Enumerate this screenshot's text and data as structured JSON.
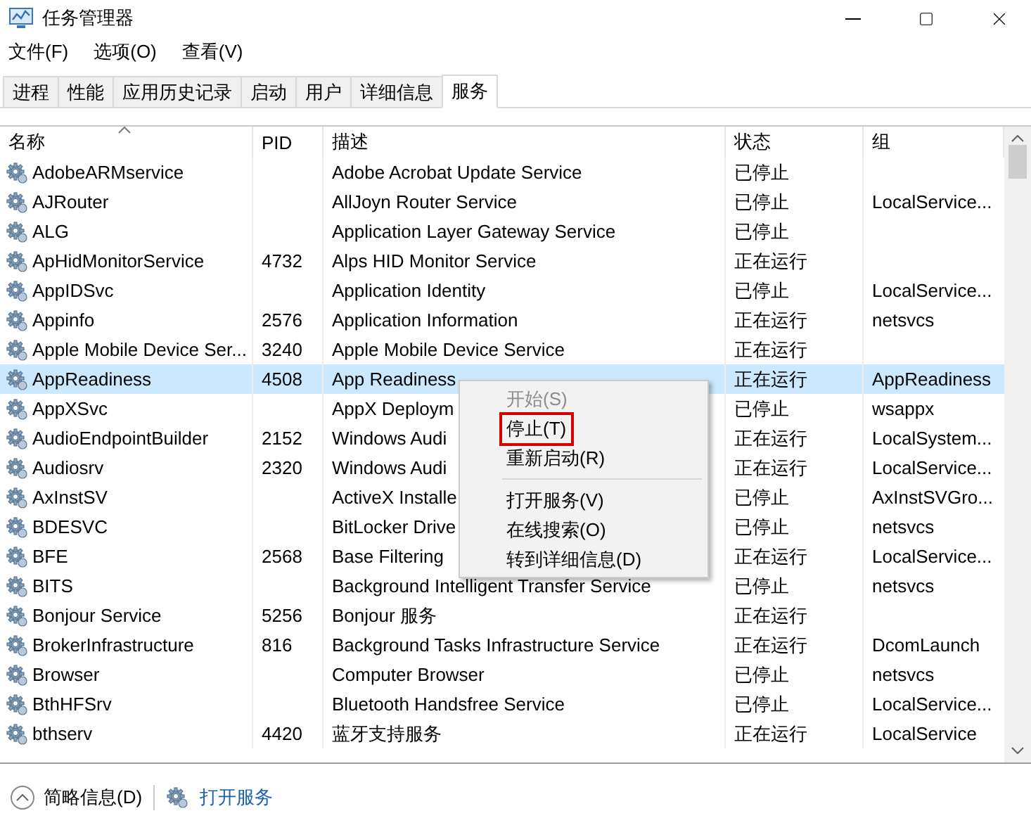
{
  "window": {
    "title": "任务管理器"
  },
  "menu_bar": [
    "文件(F)",
    "选项(O)",
    "查看(V)"
  ],
  "tabs": [
    {
      "label": "进程",
      "selected": false
    },
    {
      "label": "性能",
      "selected": false
    },
    {
      "label": "应用历史记录",
      "selected": false
    },
    {
      "label": "启动",
      "selected": false
    },
    {
      "label": "用户",
      "selected": false
    },
    {
      "label": "详细信息",
      "selected": false
    },
    {
      "label": "服务",
      "selected": true
    }
  ],
  "table": {
    "columns": [
      "名称",
      "PID",
      "描述",
      "状态",
      "组"
    ],
    "rows": [
      {
        "name": "AdobeARMservice",
        "pid": "",
        "description": "Adobe Acrobat Update Service",
        "status": "已停止",
        "group": "",
        "selected": false
      },
      {
        "name": "AJRouter",
        "pid": "",
        "description": "AllJoyn Router Service",
        "status": "已停止",
        "group": "LocalService...",
        "selected": false
      },
      {
        "name": "ALG",
        "pid": "",
        "description": "Application Layer Gateway Service",
        "status": "已停止",
        "group": "",
        "selected": false
      },
      {
        "name": "ApHidMonitorService",
        "pid": "4732",
        "description": "Alps HID Monitor Service",
        "status": "正在运行",
        "group": "",
        "selected": false
      },
      {
        "name": "AppIDSvc",
        "pid": "",
        "description": "Application Identity",
        "status": "已停止",
        "group": "LocalService...",
        "selected": false
      },
      {
        "name": "Appinfo",
        "pid": "2576",
        "description": "Application Information",
        "status": "正在运行",
        "group": "netsvcs",
        "selected": false
      },
      {
        "name": "Apple Mobile Device Ser...",
        "pid": "3240",
        "description": "Apple Mobile Device Service",
        "status": "正在运行",
        "group": "",
        "selected": false
      },
      {
        "name": "AppReadiness",
        "pid": "4508",
        "description": "App Readiness",
        "status": "正在运行",
        "group": "AppReadiness",
        "selected": true
      },
      {
        "name": "AppXSvc",
        "pid": "",
        "description": "AppX Deploym",
        "status": "已停止",
        "group": "wsappx",
        "selected": false
      },
      {
        "name": "AudioEndpointBuilder",
        "pid": "2152",
        "description": "Windows Audi",
        "status": "正在运行",
        "group": "LocalSystem...",
        "selected": false
      },
      {
        "name": "Audiosrv",
        "pid": "2320",
        "description": "Windows Audi",
        "status": "正在运行",
        "group": "LocalService...",
        "selected": false
      },
      {
        "name": "AxInstSV",
        "pid": "",
        "description": "ActiveX Installe",
        "status": "已停止",
        "group": "AxInstSVGro...",
        "selected": false
      },
      {
        "name": "BDESVC",
        "pid": "",
        "description": "BitLocker Drive",
        "status": "已停止",
        "group": "netsvcs",
        "selected": false
      },
      {
        "name": "BFE",
        "pid": "2568",
        "description": "Base Filtering",
        "status": "正在运行",
        "group": "LocalService...",
        "selected": false
      },
      {
        "name": "BITS",
        "pid": "",
        "description": "Background Intelligent Transfer Service",
        "status": "已停止",
        "group": "netsvcs",
        "selected": false
      },
      {
        "name": "Bonjour Service",
        "pid": "5256",
        "description": "Bonjour 服务",
        "status": "正在运行",
        "group": "",
        "selected": false
      },
      {
        "name": "BrokerInfrastructure",
        "pid": "816",
        "description": "Background Tasks Infrastructure Service",
        "status": "正在运行",
        "group": "DcomLaunch",
        "selected": false
      },
      {
        "name": "Browser",
        "pid": "",
        "description": "Computer Browser",
        "status": "已停止",
        "group": "netsvcs",
        "selected": false
      },
      {
        "name": "BthHFSrv",
        "pid": "",
        "description": "Bluetooth Handsfree Service",
        "status": "已停止",
        "group": "LocalService...",
        "selected": false
      },
      {
        "name": "bthserv",
        "pid": "4420",
        "description": "蓝牙支持服务",
        "status": "正在运行",
        "group": "LocalService",
        "selected": false
      }
    ]
  },
  "context_menu": [
    {
      "label": "开始(S)",
      "kind": "item",
      "disabled": true,
      "highlighted": false
    },
    {
      "label": "停止(T)",
      "kind": "item",
      "disabled": false,
      "highlighted": true
    },
    {
      "label": "重新启动(R)",
      "kind": "item",
      "disabled": false,
      "highlighted": false
    },
    {
      "kind": "separator"
    },
    {
      "label": "打开服务(V)",
      "kind": "item",
      "disabled": false,
      "highlighted": false
    },
    {
      "label": "在线搜索(O)",
      "kind": "item",
      "disabled": false,
      "highlighted": false
    },
    {
      "label": "转到详细信息(D)",
      "kind": "item",
      "disabled": false,
      "highlighted": false
    }
  ],
  "footer": {
    "details_toggle": "简略信息(D)",
    "open_services": "打开服务"
  }
}
